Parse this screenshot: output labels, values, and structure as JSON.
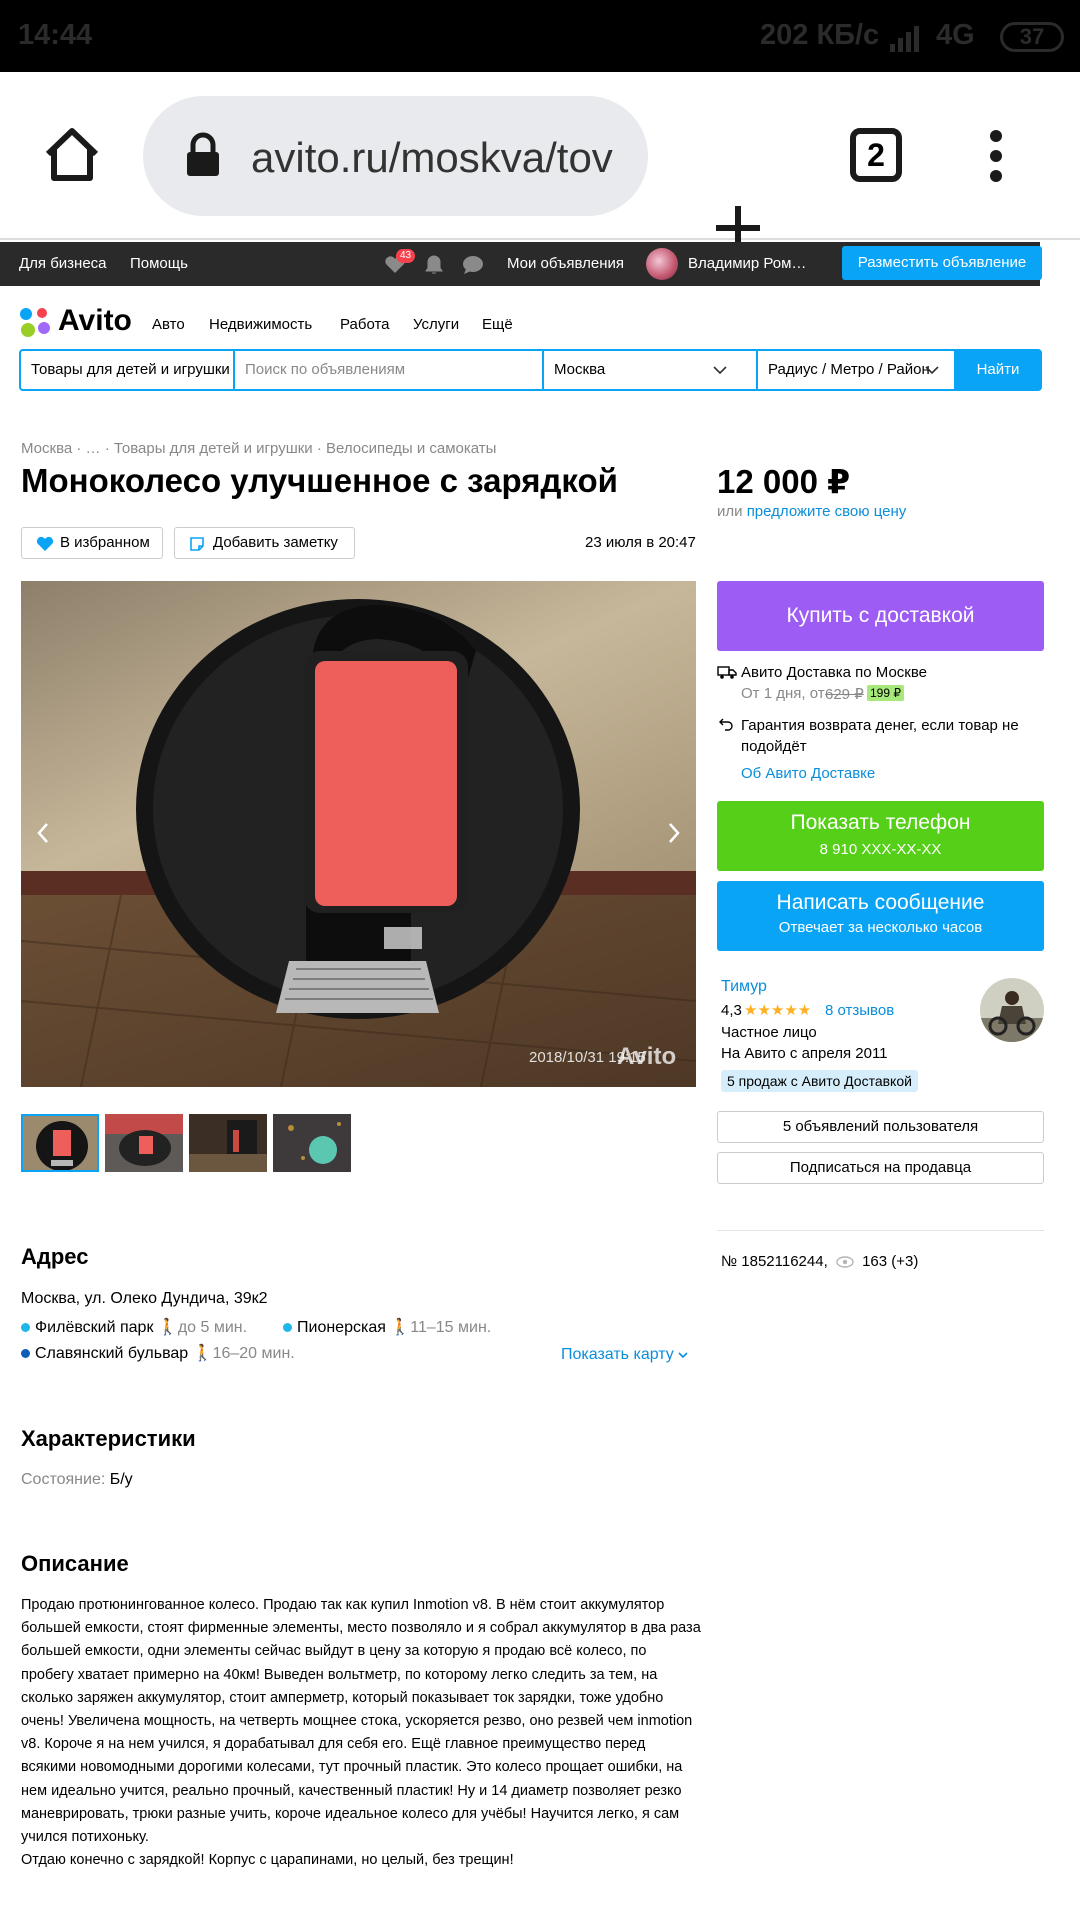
{
  "status_bar": {
    "time": "14:44",
    "speed": "202 КБ/с",
    "network": "4G",
    "battery": "37"
  },
  "browser": {
    "url": "avito.ru/moskva/tov",
    "tab_count": "2"
  },
  "topbar": {
    "for_business": "Для бизнеса",
    "help": "Помощь",
    "favorites_count": "43",
    "my_ads": "Мои объявления",
    "user_name": "Владимир Ром…",
    "post_ad": "Разместить объявление"
  },
  "nav": {
    "logo": "Avito",
    "links": [
      "Авто",
      "Недвижимость",
      "Работа",
      "Услуги",
      "Ещё"
    ]
  },
  "search": {
    "category": "Товары для детей и игрушки",
    "placeholder": "Поиск по объявлениям",
    "city": "Москва",
    "radius": "Радиус / Метро / Район",
    "find": "Найти"
  },
  "breadcrumbs": "Москва · … · Товары для детей и игрушки · Велосипеды и самокаты",
  "item": {
    "title": "Моноколесо улучшенное с зарядкой",
    "favorite_btn": "В избранном",
    "note_btn": "Добавить заметку",
    "date": "23 июля в 20:47",
    "photo_stamp": "2018/10/31 19:15",
    "photo_watermark": "Avito"
  },
  "price": {
    "value": "12 000 ₽",
    "or": "или",
    "offer_link": "предложите свою цену"
  },
  "delivery": {
    "buy_btn": "Купить с доставкой",
    "line1": "Авито Доставка по Москве",
    "line2_prefix": "От 1 дня, от",
    "old_price": "629 ₽",
    "new_price": "199 ₽",
    "guarantee": "Гарантия возврата денег, если товар не подойдёт",
    "about": "Об Авито Доставке"
  },
  "contact": {
    "phone_btn": "Показать телефон",
    "phone_mask": "8 910 XXX-XX-XX",
    "msg_btn": "Написать сообщение",
    "msg_sub": "Отвечает за несколько часов"
  },
  "seller": {
    "name": "Тимур",
    "rating": "4,3",
    "stars": "★★★★★",
    "reviews": "8 отзывов",
    "type": "Частное лицо",
    "since": "На Авито с апреля 2011",
    "badge": "5 продаж с Авито Доставкой",
    "ads_btn": "5 объявлений пользователя",
    "subscribe_btn": "Подписаться на продавца"
  },
  "ad_meta": {
    "number": "№ 1852116244,",
    "views": "163 (+3)"
  },
  "address": {
    "heading": "Адрес",
    "text": "Москва, ул. Олеко Дундича, 39к2",
    "metro": [
      {
        "name": "Филёвский парк",
        "time": "до 5 мин.",
        "color": "#1fb6e8"
      },
      {
        "name": "Пионерская",
        "time": "11–15 мин.",
        "color": "#1fb6e8"
      },
      {
        "name": "Славянский бульвар",
        "time": "16–20 мин.",
        "color": "#0a5fb4"
      }
    ],
    "show_map": "Показать карту"
  },
  "specs": {
    "heading": "Характеристики",
    "label": "Состояние:",
    "value": "Б/у"
  },
  "description": {
    "heading": "Описание",
    "text": "Продаю протюнингованное колесо. Продаю так как купил Inmotion v8. В нём стоит аккумулятор большей емкости, стоят фирменные элементы, место позволяло и я собрал аккумулятор в два раза большей емкости, одни элементы сейчас выйдут в цену за которую я продаю всё колесо, по пробегу хватает примерно на 40км! Выведен вольтметр, по которому легко следить за тем, на сколько заряжен аккумулятор, стоит амперметр, который показывает ток зарядки, тоже удобно очень! Увеличена мощность, на четверть мощнее стока, ускоряется резво, оно резвей чем inmotion v8. Короче я на нем учился, я дорабатывал для себя его. Ещё главное преимущество перед всякими новомодными дорогими колесами, тут прочный пластик. Это колесо прощает ошибки, на нем идеально учится, реально прочный, качественный пластик! Ну и 14 диаметр позволяет резко маневрировать, трюки разные учить, короче идеальное колесо для учёбы! Научится легко, я сам учился потихоньку.",
    "text2": "Отдаю конечно с зарядкой! Корпус с царапинами, но целый, без трещин!"
  }
}
